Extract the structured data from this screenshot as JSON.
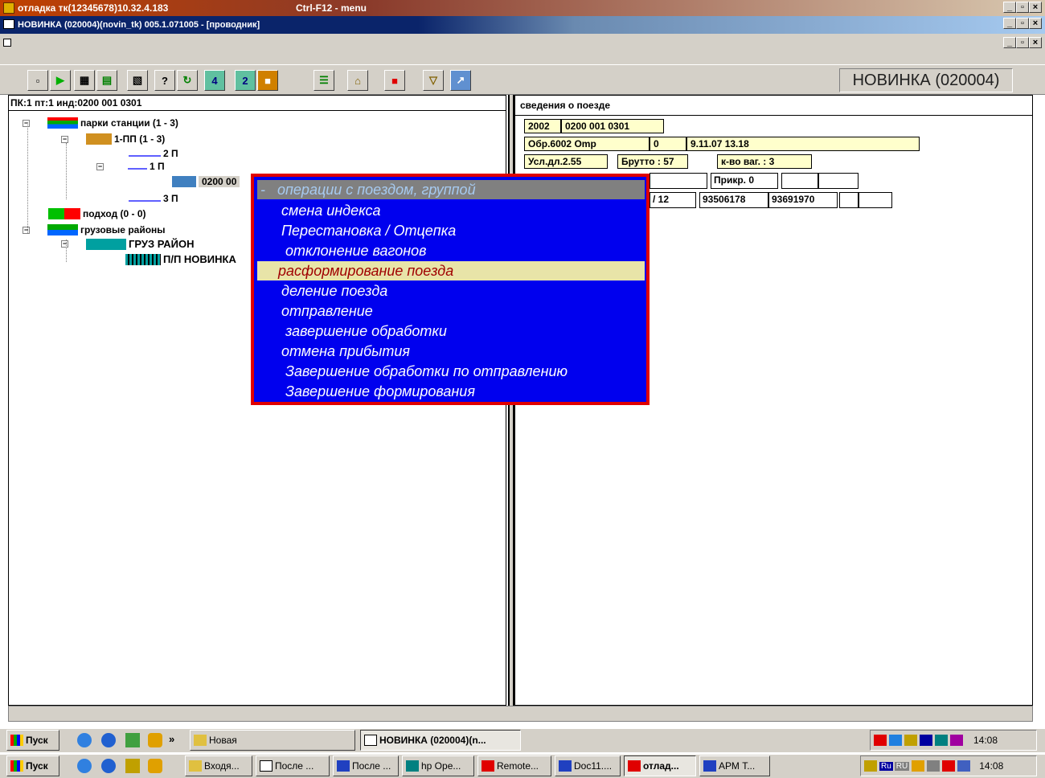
{
  "window": {
    "title": "отладка тк(12345678)10.32.4.183",
    "menu_hint": "Ctrl-F12 - menu",
    "sub_title": "НОВИНКА (020004)(novin_tk) 005.1.071005 - [проводник]",
    "controls": [
      "_",
      "▫",
      "×"
    ]
  },
  "toolbar": {
    "station_label": "НОВИНКА (020004)"
  },
  "left_panel": {
    "header": "ПК:1 пт:1 инд:0200 001 0301",
    "tree": [
      {
        "label": "парки станции (1 - 3)"
      },
      {
        "label": "1-ПП (1 - 3)"
      },
      {
        "label": "2 П"
      },
      {
        "label": "1 П"
      },
      {
        "label": "0200 00"
      },
      {
        "label": "3 П"
      },
      {
        "label": "подход (0 - 0)"
      },
      {
        "label": "грузовые районы"
      },
      {
        "label": "ГРУЗ РАЙОН"
      },
      {
        "label": "П/П НОВИНКА"
      }
    ]
  },
  "right_panel": {
    "header": "сведения о поезде",
    "row1": {
      "num": "2002",
      "index": "0200 001 0301"
    },
    "row2": {
      "obr": "Обр.6002 Оmp",
      "flag": "0",
      "datetime": "9.11.07 13.18"
    },
    "row3": {
      "usl": "Усл.дл.2.55",
      "brutto": "Брутто : 57",
      "kvo": "к-во ваг. : 3"
    },
    "row4": {
      "prikr": "Прикр. 0"
    },
    "row5": {
      "frac": "/ 12",
      "wagon1": "93506178",
      "wagon2": "93691970"
    }
  },
  "context_menu": {
    "title": "операции с поездом, группой",
    "items": [
      {
        "label": "смена индекса"
      },
      {
        "label": "Перестановка / Отцепка"
      },
      {
        "label": " отклонение вагонов"
      },
      {
        "label": "расформирование поезда",
        "selected": true
      },
      {
        "label": "деление поезда"
      },
      {
        "label": "отправление"
      },
      {
        "label": " завершение обработки"
      },
      {
        "label": "отмена прибытия"
      },
      {
        "label": " Завершение обработки по отправлению"
      },
      {
        "label": " Завершение формирования"
      }
    ]
  },
  "taskbar1": {
    "start": "Пуск",
    "more": "»",
    "item1": "Новая",
    "item2": "НОВИНКА (020004)(n...",
    "clock": "14:08"
  },
  "taskbar2": {
    "start": "Пуск",
    "items": [
      "Входя...",
      "После ...",
      "После ...",
      "hp Ope...",
      "Remote...",
      "Doc11....",
      "отлад...",
      "АРМ Т..."
    ],
    "tray_ru": "Ru",
    "tray_ru2": "RU",
    "clock": "14:08"
  },
  "colors": {
    "title_active": "#0a246a",
    "menu_blue": "#0000ee",
    "menu_sel": "#e8e4a8",
    "menu_border": "#e00000"
  }
}
